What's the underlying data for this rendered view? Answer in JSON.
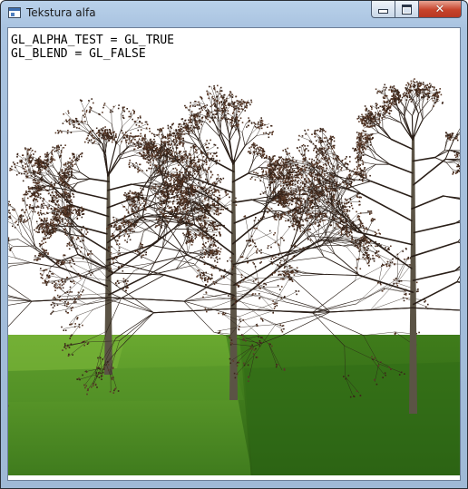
{
  "window": {
    "title": "Tekstura alfa",
    "buttons": {
      "minimize": "minimize",
      "maximize": "maximize",
      "close": "close"
    },
    "close_glyph": "✕"
  },
  "overlay": {
    "line1": "GL_ALPHA_TEST = GL_TRUE",
    "line2": "GL_BLEND = GL_FALSE"
  },
  "scene": {
    "sky_color": "#ffffff",
    "grass_colors": [
      "#3f7a1c",
      "#5a9a2a",
      "#7fb83c"
    ],
    "trunk_color": "#5b5345",
    "branch_color": "#2a1f18"
  },
  "icons": [
    "app-icon",
    "minimize-icon",
    "maximize-icon",
    "close-icon"
  ]
}
